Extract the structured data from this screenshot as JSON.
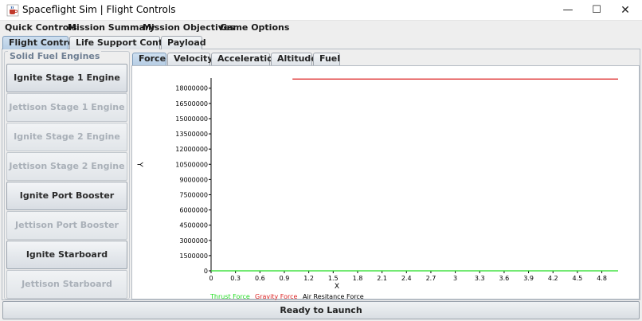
{
  "window": {
    "title": "Spaceflight Sim | Flight Controls",
    "icon": "coffee-cup-icon",
    "minimize": "—",
    "maximize": "☐",
    "close": "✕"
  },
  "menu": [
    "Quick Controls",
    "Mission Summary",
    "Mission Objectives",
    "Game Options"
  ],
  "main_tabs": [
    {
      "label": "Flight Controls",
      "selected": true
    },
    {
      "label": "Life Support Controls",
      "selected": false
    },
    {
      "label": "Payload",
      "selected": false
    }
  ],
  "engines": {
    "title": "Solid Fuel Engines",
    "buttons": [
      {
        "label": "Ignite Stage 1 Engine",
        "enabled": true
      },
      {
        "label": "Jettison Stage 1 Engine",
        "enabled": false
      },
      {
        "label": "Ignite Stage 2 Engine",
        "enabled": false
      },
      {
        "label": "Jettison Stage 2 Engine",
        "enabled": false
      },
      {
        "label": "Ignite Port Booster",
        "enabled": true
      },
      {
        "label": "Jettison Port Booster",
        "enabled": false
      },
      {
        "label": "Ignite Starboard Booster",
        "enabled": true
      },
      {
        "label": "Jettison Starboard Booster",
        "enabled": false
      }
    ]
  },
  "graph_tabs": [
    {
      "label": "Force",
      "selected": true
    },
    {
      "label": "Velocity",
      "selected": false
    },
    {
      "label": "Acceleration",
      "selected": false
    },
    {
      "label": "Altitude",
      "selected": false
    },
    {
      "label": "Fuel",
      "selected": false
    }
  ],
  "chart_data": {
    "type": "line",
    "xlabel": "X",
    "ylabel": "Y",
    "xlim": [
      0,
      5.0
    ],
    "ylim": [
      0,
      19000000
    ],
    "x_ticks": [
      "0",
      "0.3",
      "0.6",
      "0.9",
      "1.2",
      "1.5",
      "1.8",
      "2.1",
      "2.4",
      "2.7",
      "3",
      "3.3",
      "3.6",
      "3.9",
      "4.2",
      "4.5",
      "4.8"
    ],
    "y_ticks": [
      "0",
      "1500000",
      "3000000",
      "4500000",
      "6000000",
      "7500000",
      "9000000",
      "10500000",
      "12000000",
      "13500000",
      "15000000",
      "16500000",
      "18000000"
    ],
    "series": [
      {
        "name": "Thrust Force",
        "color": "#22dd22",
        "x": [
          0.0,
          5.0
        ],
        "y": [
          0,
          0
        ]
      },
      {
        "name": "Gravity Force",
        "color": "#dd2222",
        "x": [
          1.0,
          5.0
        ],
        "y": [
          18900000,
          18900000
        ]
      },
      {
        "name": "Air Resitance Force",
        "color": "#000000",
        "x": [],
        "y": []
      }
    ],
    "legend_position": "bottom-left",
    "grid": false
  },
  "status": "Ready to Launch"
}
